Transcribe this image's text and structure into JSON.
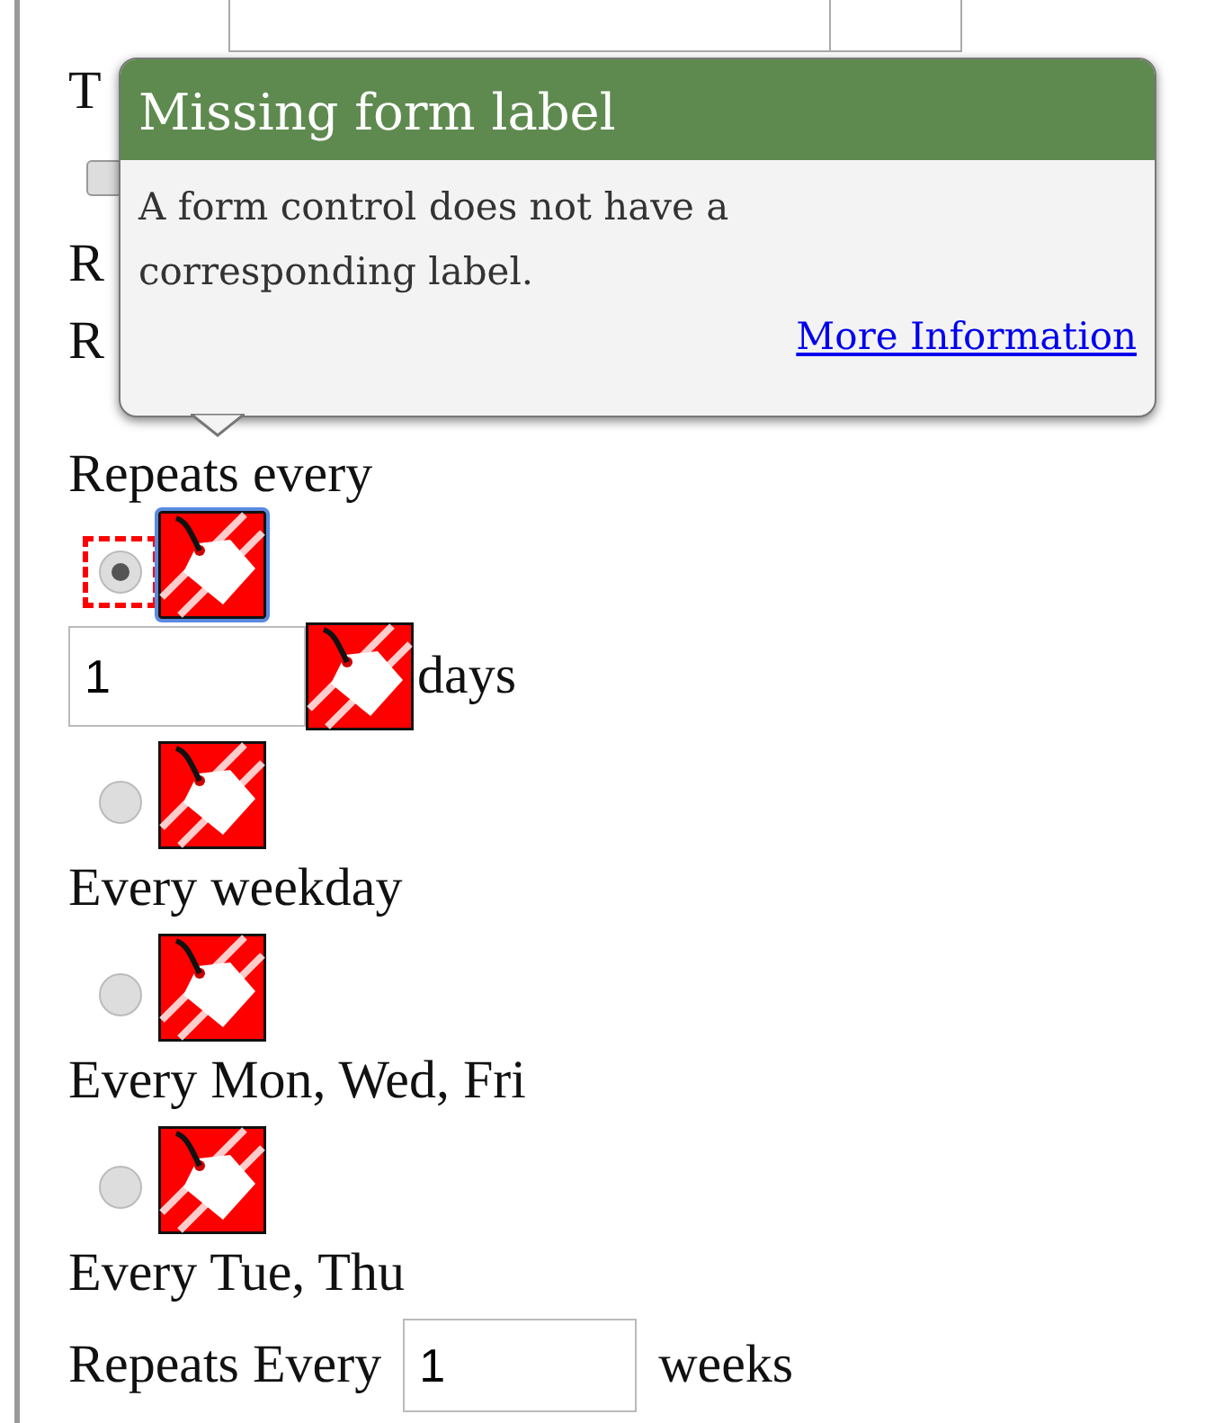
{
  "lines": [
    {
      "kind": "text",
      "text": "T"
    },
    {
      "kind": "checkbox",
      "checked": false
    },
    {
      "kind": "text",
      "text": "R"
    },
    {
      "kind": "text",
      "text": "R"
    },
    {
      "kind": "text",
      "text": "Repeats every"
    },
    {
      "kind": "radio",
      "selected": true,
      "flagged": true
    },
    {
      "kind": "count",
      "value": "1",
      "unit": "days"
    },
    {
      "kind": "radio",
      "selected": false,
      "flagged": false
    },
    {
      "kind": "text",
      "text": "Every weekday"
    },
    {
      "kind": "radio",
      "selected": false,
      "flagged": false
    },
    {
      "kind": "text",
      "text": "Every Mon, Wed, Fri"
    },
    {
      "kind": "radio",
      "selected": false,
      "flagged": false
    },
    {
      "kind": "text",
      "text": "Every Tue, Thu"
    },
    {
      "kind": "repeat",
      "label": "Repeats Every",
      "value": "1",
      "unit": "weeks"
    }
  ],
  "tooltip": {
    "title": "Missing form label",
    "message": "A form control does not have a corresponding label.",
    "link": "More Information"
  }
}
